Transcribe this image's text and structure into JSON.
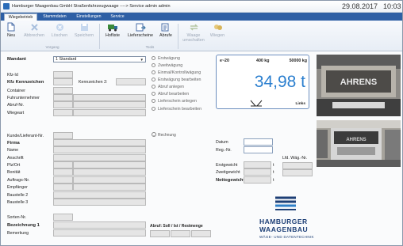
{
  "window": {
    "title": "Hamburger Waagenbau GmbH   Straßenfahrzeugwaage   ----> Service admin admin",
    "date": "29.08.2017",
    "time": "10:03"
  },
  "tabs": [
    {
      "label": "Wiegebetrieb",
      "active": true
    },
    {
      "label": "Stammdaten",
      "active": false
    },
    {
      "label": "Einstellungen",
      "active": false
    },
    {
      "label": "Service",
      "active": false
    }
  ],
  "ribbon": {
    "buttons": [
      {
        "label": "Neu",
        "icon": "new-document-icon",
        "enabled": true
      },
      {
        "label": "Abbrechen",
        "icon": "cancel-x-icon",
        "enabled": false
      },
      {
        "label": "Löschen",
        "icon": "delete-icon",
        "enabled": false
      },
      {
        "label": "Speichern",
        "icon": "save-icon",
        "enabled": false
      },
      {
        "label": "Hofliste",
        "icon": "truck-list-icon",
        "enabled": true
      },
      {
        "label": "Lieferscheine",
        "icon": "delivery-note-icon",
        "enabled": true
      },
      {
        "label": "Abrufe",
        "icon": "call-off-icon",
        "enabled": true
      },
      {
        "label": "Waage umschalten",
        "icon": "switch-scale-icon",
        "enabled": false
      },
      {
        "label": "Wiegen",
        "icon": "weigh-icon",
        "enabled": false
      }
    ],
    "groups": {
      "vorgang": "Vorgang",
      "tools": "Tools"
    }
  },
  "form": {
    "mandant_label": "Mandant",
    "mandant_value": "1 Standard",
    "kfz_id": "Kfz-Id",
    "kfz_kennzeichen": "Kfz Kennzeichen",
    "kennzeichen2": "Kennzeichen 2:",
    "container": "Container",
    "fuhrunternehmer": "Fuhrunternehmer",
    "abruf_nr": "Abruf-Nr.",
    "wiegeart": "Wiegeart",
    "kunde_lieferant": "Kunde/Lieferant-Nr.",
    "firma": "Firma",
    "name": "Name",
    "anschrift": "Anschrift",
    "plz_ort": "Plz/Ort",
    "bonitaet": "Bonität",
    "auftrags_nr": "Auftrags-Nr.",
    "empfaenger": "Empfänger",
    "baustelle2": "Baustelle 2",
    "baustelle3": "Baustelle 3",
    "sorten_nr": "Sorten-Nr.",
    "bezeichnung1": "Bezeichnung 1",
    "bemerkung": "Bemerkung",
    "abruf_soll": "Abruf: Soll / Ist / Restmenge"
  },
  "options": [
    "Erstwägung",
    "Zweitwägung",
    "Einmal/Kontrollwägung",
    "Erstwägung bearbeiten",
    "Abruf anlegen",
    "Abruf bearbeiten",
    "Lieferschein anlegen",
    "Lieferschein bearbeiten"
  ],
  "rechnung": "Rechnung",
  "right": {
    "datum": "Datum",
    "reg_nr": "Reg.-Nr.",
    "lfd_waeg_nr": "Lfd. Wäg.-Nr.",
    "erstgewicht": "Erstgewicht",
    "zweitgewicht": "Zweitgewicht",
    "nettogewicht": "Nettogewicht",
    "unit_t": "t"
  },
  "scale": {
    "header_left": "e~20",
    "header_mid": "400 kg",
    "header_right": "50000 kg",
    "value": "34,98 t",
    "side": "Links",
    "zero_icon": "zero-marker-icon"
  },
  "cameras": {
    "top_text": "AHRENS",
    "bottom_text": "AHRENS"
  },
  "logo": {
    "line1": "HAMBURGER",
    "line2": "WAAGENBAU",
    "line3": "WÄGE- UND DATENTECHNIK"
  },
  "colors": {
    "tab_bar": "#2e5fa5",
    "scale_value": "#2b7fcf",
    "logo": "#1d3f76",
    "field_bg": "#e5e5e5"
  }
}
